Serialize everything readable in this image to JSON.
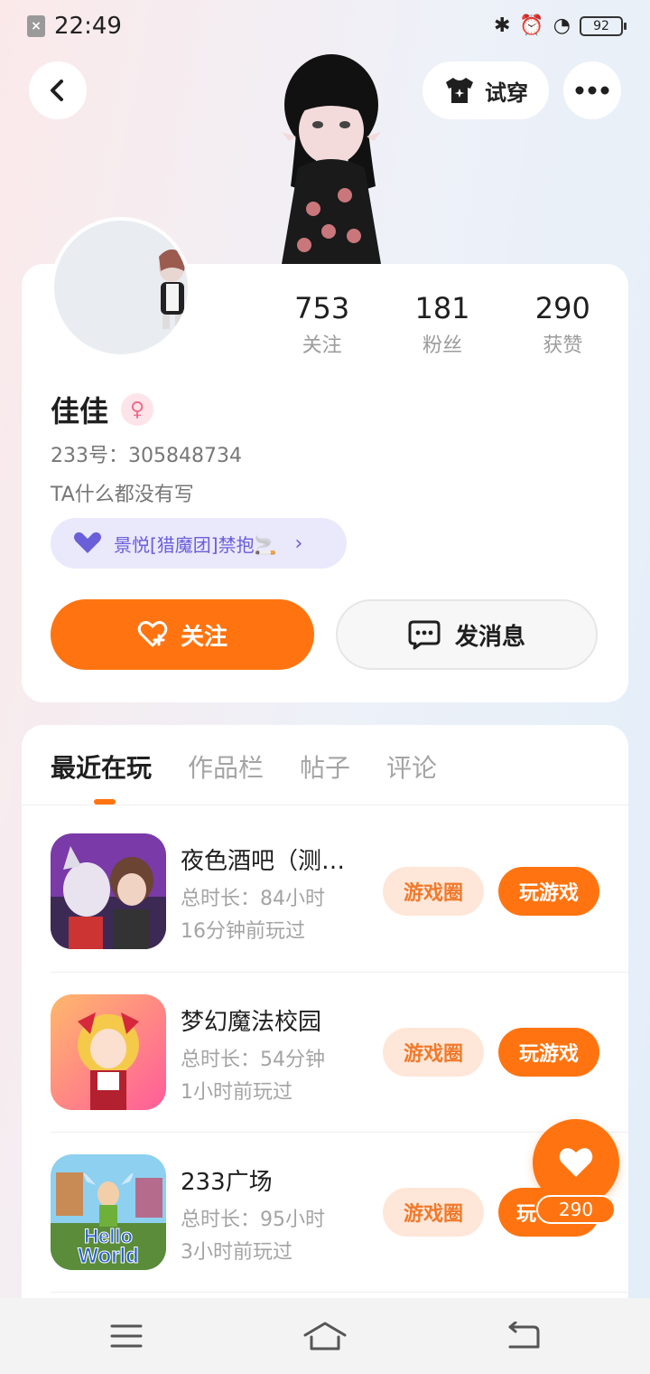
{
  "status_bar": {
    "time": "22:49",
    "battery": "92"
  },
  "header": {
    "try_on_label": "试穿"
  },
  "profile": {
    "name": "佳佳",
    "uid": "233号：305848734",
    "bio": "TA什么都没有写",
    "guild": "景悦[猎魔团]禁抱🚬",
    "stats": [
      {
        "value": "753",
        "label": "关注"
      },
      {
        "value": "181",
        "label": "粉丝"
      },
      {
        "value": "290",
        "label": "获赞"
      }
    ],
    "follow_label": "关注",
    "message_label": "发消息"
  },
  "tabs": [
    {
      "label": "最近在玩"
    },
    {
      "label": "作品栏"
    },
    {
      "label": "帖子"
    },
    {
      "label": "评论"
    }
  ],
  "games": [
    {
      "title": "夜色酒吧（测…",
      "playtime": "总时长：84小时",
      "last_played": "16分钟前玩过",
      "circle_label": "游戏圈",
      "play_label": "玩游戏"
    },
    {
      "title": "梦幻魔法校园",
      "playtime": "总时长：54分钟",
      "last_played": "1小时前玩过",
      "circle_label": "游戏圈",
      "play_label": "玩游戏"
    },
    {
      "title": "233广场",
      "playtime": "总时长：95小时",
      "last_played": "3小时前玩过",
      "circle_label": "游戏圈",
      "play_label": "玩"
    }
  ],
  "like_fab": {
    "count": "290"
  },
  "colors": {
    "accent": "#ff7410",
    "guild_text": "#6a5ed9",
    "guild_bg": "#eae8fb"
  },
  "icons": [
    "back-icon",
    "shirt-icon",
    "more-icon",
    "female-icon",
    "heart-icon",
    "follow-heart-icon",
    "message-icon",
    "menu-icon",
    "home-icon",
    "return-icon"
  ]
}
